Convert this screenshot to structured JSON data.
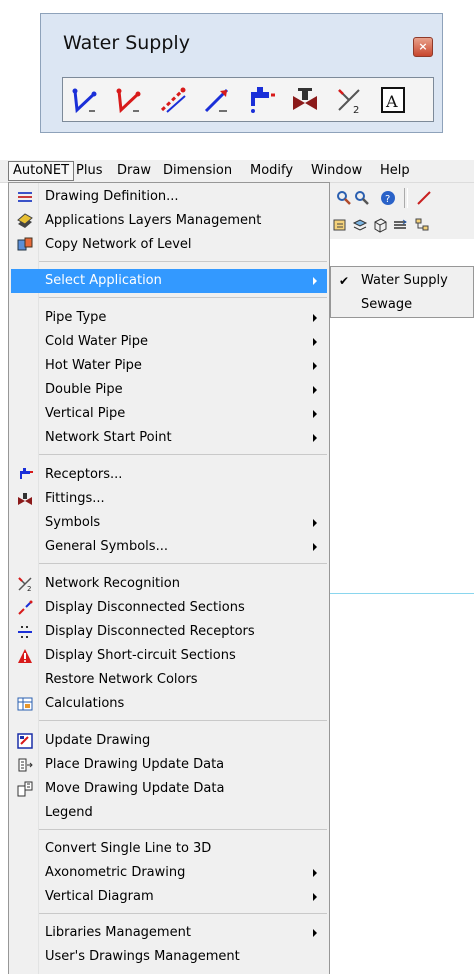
{
  "toolbar": {
    "title": "Water Supply",
    "close_glyph": "×",
    "icons": [
      "line-segment-blue-icon",
      "line-segment-red-icon",
      "dashed-line-red-icon",
      "sloped-line-blue-icon",
      "faucet-icon",
      "valve-icon",
      "network-recognition-icon",
      "annotation-a-icon"
    ]
  },
  "menubar": {
    "items": [
      "AutoNET",
      "Plus",
      "Draw",
      "Dimension",
      "Modify",
      "Window",
      "Help"
    ]
  },
  "menu": {
    "items": [
      {
        "label": "Drawing Definition...",
        "icon": "drawing-definition-icon"
      },
      {
        "label": "Applications Layers Management",
        "icon": "layers-icon"
      },
      {
        "label": "Copy Network of Level",
        "icon": "copy-network-icon"
      },
      {
        "label": "Select Application",
        "submenu": true
      },
      {
        "label": "Pipe Type",
        "submenu": true
      },
      {
        "label": "Cold Water Pipe",
        "submenu": true
      },
      {
        "label": "Hot Water Pipe",
        "submenu": true
      },
      {
        "label": "Double Pipe",
        "submenu": true
      },
      {
        "label": "Vertical Pipe",
        "submenu": true
      },
      {
        "label": "Network Start Point",
        "submenu": true
      },
      {
        "label": "Receptors...",
        "icon": "faucet-icon"
      },
      {
        "label": "Fittings...",
        "icon": "valve-icon"
      },
      {
        "label": "Symbols",
        "submenu": true
      },
      {
        "label": "General Symbols...",
        "submenu": true
      },
      {
        "label": "Network Recognition",
        "icon": "network-recognition-icon"
      },
      {
        "label": "Display Disconnected Sections",
        "icon": "disconnected-sections-icon"
      },
      {
        "label": "Display Disconnected Receptors",
        "icon": "disconnected-receptors-icon"
      },
      {
        "label": "Display Short-circuit Sections",
        "icon": "warning-icon"
      },
      {
        "label": "Restore Network Colors"
      },
      {
        "label": "Calculations",
        "icon": "calculations-icon"
      },
      {
        "label": "Update Drawing",
        "icon": "update-drawing-icon"
      },
      {
        "label": "Place Drawing Update Data",
        "icon": "place-update-data-icon"
      },
      {
        "label": "Move Drawing Update Data",
        "icon": "move-update-data-icon"
      },
      {
        "label": "Legend"
      },
      {
        "label": "Convert Single Line to 3D"
      },
      {
        "label": "Axonometric Drawing",
        "submenu": true
      },
      {
        "label": "Vertical Diagram",
        "submenu": true
      },
      {
        "label": "Libraries Management",
        "submenu": true
      },
      {
        "label": "User's Drawings Management"
      }
    ]
  },
  "submenu": {
    "items": [
      {
        "label": "Water Supply",
        "checked": true
      },
      {
        "label": "Sewage",
        "checked": false
      }
    ]
  },
  "colors": {
    "highlight": "#3399ff",
    "menu_bg": "#f0f0f0",
    "toolbar_bg": "#dce6f3",
    "close_button": "#c8462d"
  }
}
